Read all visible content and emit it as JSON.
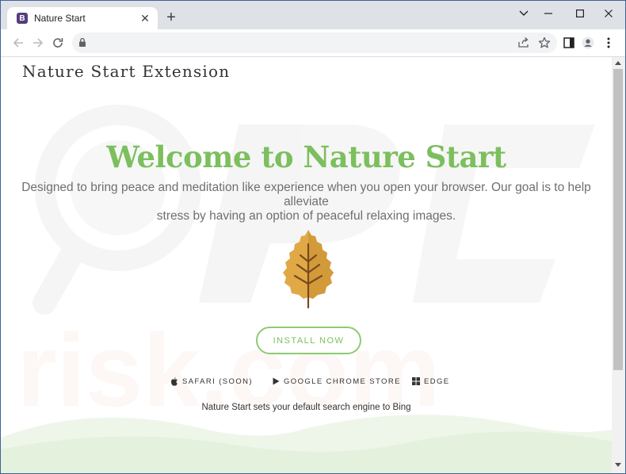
{
  "browser": {
    "tab_title": "Nature Start",
    "favicon_letter": "B",
    "favicon_color": "#563d7c",
    "tab_close_glyph": "✕",
    "new_tab_glyph": "+",
    "icons": [
      "back-arrow-icon",
      "forward-arrow-icon",
      "reload-icon",
      "lock-icon",
      "share-icon",
      "star-icon",
      "sidebar-icon",
      "profile-icon",
      "kebab-menu-icon"
    ]
  },
  "page": {
    "brand": "Nature Start Extension",
    "headline": "Welcome to Nature Start",
    "tagline_line1": "Designed to bring peace and meditation like experience when you open your browser. Our goal is to help alleviate",
    "tagline_line2": "stress by having an option of peaceful relaxing images.",
    "install_label": "INSTALL NOW",
    "stores": [
      {
        "label": "SAFARI (SOON)",
        "icon": "apple-icon"
      },
      {
        "label": "GOOGLE CHROME STORE",
        "icon": "play-icon"
      },
      {
        "label": "EDGE",
        "icon": "windows-icon"
      }
    ],
    "footnote": "Nature Start sets your default search engine to Bing",
    "accent_color": "#7cbf5e",
    "leaf_color": "#e0a946"
  }
}
